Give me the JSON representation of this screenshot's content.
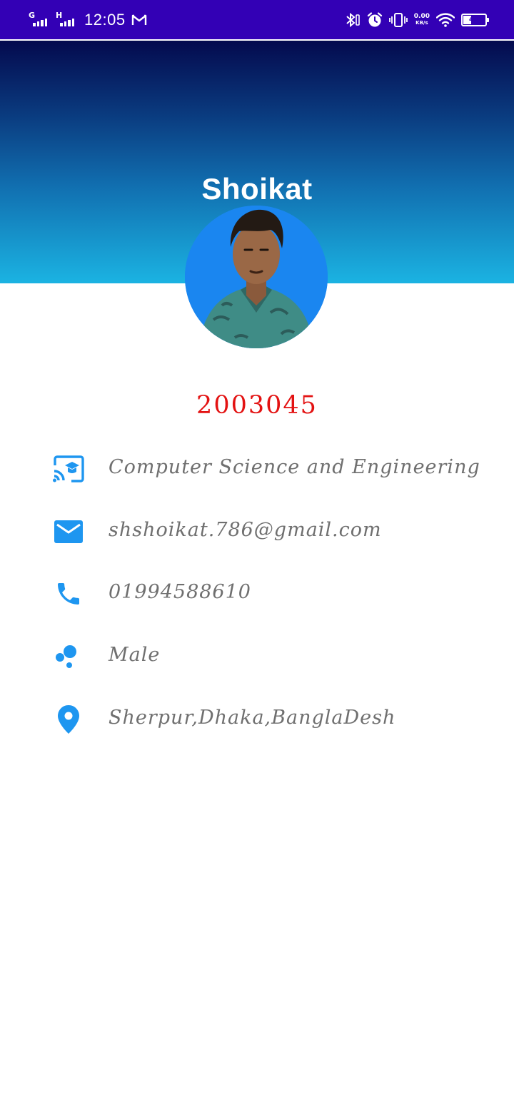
{
  "status_bar": {
    "signal1_label": "G",
    "signal2_label": "H",
    "time": "12:05",
    "net_speed_value": "0.00",
    "net_speed_unit": "KB/s",
    "battery_level": "40",
    "battery_fraction": 0.4,
    "icons": [
      "gmail-icon",
      "bluetooth-icon",
      "alarm-icon",
      "vibrate-icon",
      "wifi-icon",
      "battery-icon"
    ]
  },
  "profile": {
    "name": "Shoikat",
    "student_id": "2003045"
  },
  "info": {
    "department": "Computer Science and Engineering",
    "email": "shshoikat.786@gmail.com",
    "phone": "01994588610",
    "gender": "Male",
    "address": "Sherpur,Dhaka,BanglaDesh"
  },
  "colors": {
    "status_bar": "#3300b5",
    "header_top": "#040a4e",
    "header_bottom": "#1bb3e2",
    "accent_icon": "#1e96f0",
    "student_id": "#e31212",
    "info_text": "#6f6f6f"
  }
}
